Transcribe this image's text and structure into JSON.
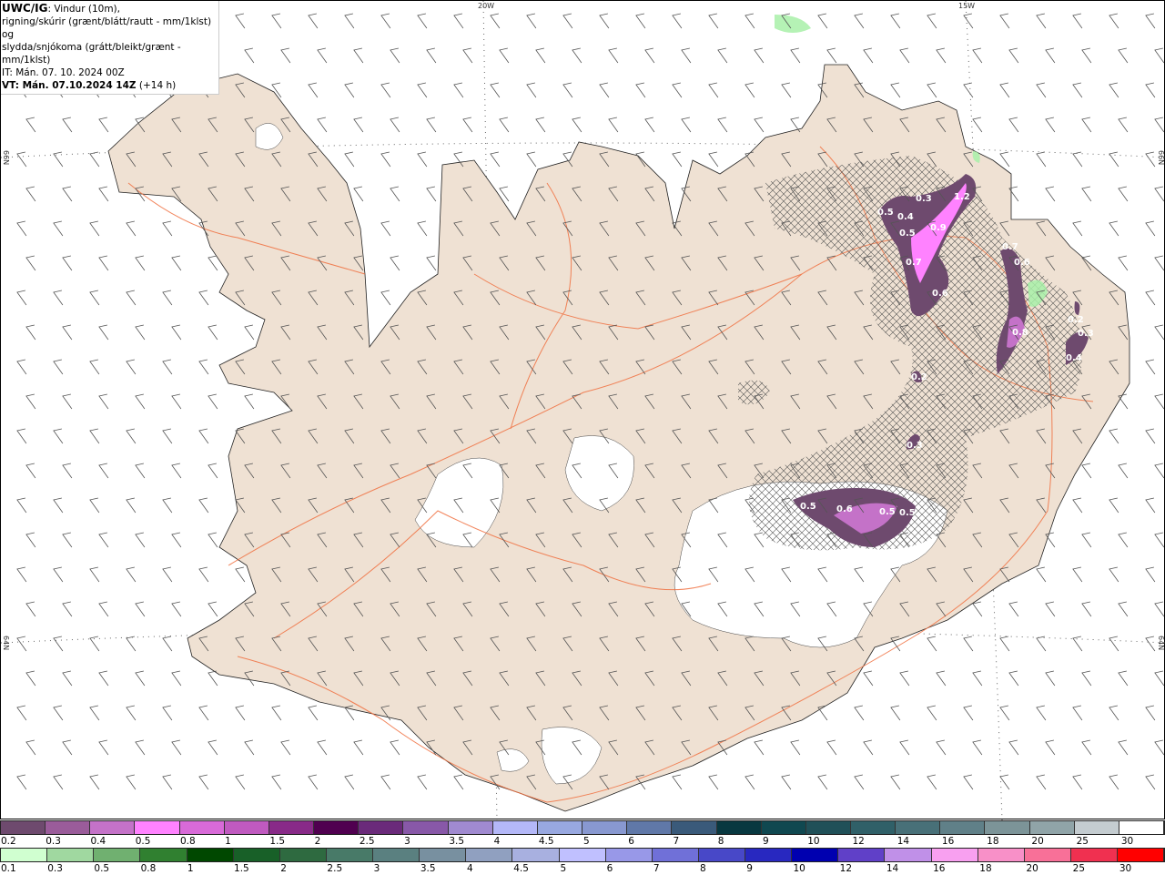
{
  "header": {
    "model": "UWC/IG",
    "line1": ": Vindur (10m),",
    "line2": "rigning/skúrir (grænt/blátt/rautt - mm/1klst) og",
    "line3": "slydda/snjókoma (grátt/bleikt/grænt - mm/1klst)",
    "it": "IT: Mán. 07. 10. 2024 00Z",
    "vt": "VT: Mán. 07.10.2024 14Z",
    "vt_offset": " (+14 h)"
  },
  "grid_labels": {
    "lon_20w": "20W",
    "lon_15w": "15W",
    "lat_66n": "66N",
    "lat_64n": "64N"
  },
  "precip_labels": [
    {
      "v": "0.5"
    },
    {
      "v": "0.4"
    },
    {
      "v": "0.3"
    },
    {
      "v": "1.2"
    },
    {
      "v": "0.9"
    },
    {
      "v": "0.5"
    },
    {
      "v": "0.7"
    },
    {
      "v": "0.6"
    },
    {
      "v": "0.7"
    },
    {
      "v": "0.6"
    },
    {
      "v": "0.8"
    },
    {
      "v": "0.2"
    },
    {
      "v": "0.3"
    },
    {
      "v": "0.4"
    },
    {
      "v": "0.2"
    },
    {
      "v": "0.3"
    },
    {
      "v": "0.5"
    },
    {
      "v": "0.6"
    },
    {
      "v": "0.5"
    },
    {
      "v": "0.5"
    }
  ],
  "legend_snow": {
    "labels": [
      "0.2",
      "0.3",
      "0.4",
      "0.5",
      "0.8",
      "1",
      "1.5",
      "2",
      "2.5",
      "3",
      "3.5",
      "4",
      "4.5",
      "5",
      "6",
      "7",
      "8",
      "9",
      "10",
      "12",
      "14",
      "16",
      "18",
      "20",
      "25",
      "30"
    ],
    "colors": [
      "#6e4a6e",
      "#9a5c9a",
      "#c472c8",
      "#ff82ff",
      "#d86ad8",
      "#c05ac0",
      "#882a88",
      "#500050",
      "#6a2a7a",
      "#8858a8",
      "#a08ad0",
      "#b4b8f8",
      "#98a8e0",
      "#8898d0",
      "#6078a8",
      "#3a5a7a",
      "#083840",
      "#104850",
      "#205058",
      "#306068",
      "#487078",
      "#608088",
      "#7c9498",
      "#90a4a8",
      "#c4ccd0",
      "#ffffff"
    ]
  },
  "legend_rain": {
    "labels": [
      "0.1",
      "0.3",
      "0.5",
      "0.8",
      "1",
      "1.5",
      "2",
      "2.5",
      "3",
      "3.5",
      "4",
      "4.5",
      "5",
      "6",
      "7",
      "8",
      "9",
      "10",
      "12",
      "14",
      "16",
      "18",
      "20",
      "25",
      "30"
    ],
    "colors": [
      "#d0ffd0",
      "#a0d8a0",
      "#70b070",
      "#308030",
      "#004800",
      "#186028",
      "#2e6a40",
      "#487a68",
      "#5a8080",
      "#7890a0",
      "#90a0c0",
      "#a8b0e0",
      "#c0c0ff",
      "#9898e8",
      "#7070d8",
      "#4848c8",
      "#2828c0",
      "#0000b0",
      "#6040c8",
      "#c090e8",
      "#f8a0f0",
      "#f890c8",
      "#f87098",
      "#f03050",
      "#ff0000"
    ]
  }
}
